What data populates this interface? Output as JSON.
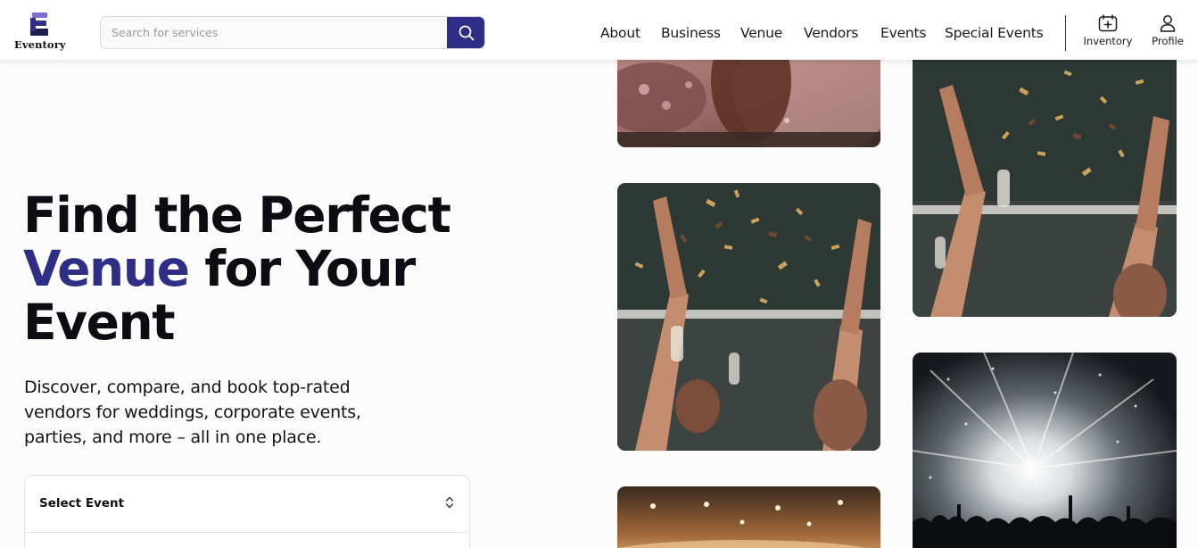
{
  "brand": {
    "name": "Eventory",
    "color": "#2f2e86"
  },
  "search": {
    "placeholder": "Search for services",
    "value": "",
    "icon": "search-icon"
  },
  "nav": {
    "links": [
      "About",
      "Business",
      "Venue",
      "Vendors",
      "Events",
      "Special Events"
    ],
    "inventory_label": "Inventory",
    "profile_label": "Profile"
  },
  "hero": {
    "title_line1": "Find the Perfect",
    "title_accent": "Venue",
    "title_line2_rest": " for Your",
    "title_line3": "Event",
    "subtitle": "Discover, compare, and book top-rated vendors for weddings, corporate events, parties, and more – all in one place."
  },
  "event_select": {
    "label": "Select Event"
  },
  "gallery": [
    "party-photo-icon",
    "confetti-celebration-photo-icon",
    "confetti-celebration-photo-icon",
    "concert-lights-photo-icon",
    "dinner-venue-photo-icon"
  ]
}
